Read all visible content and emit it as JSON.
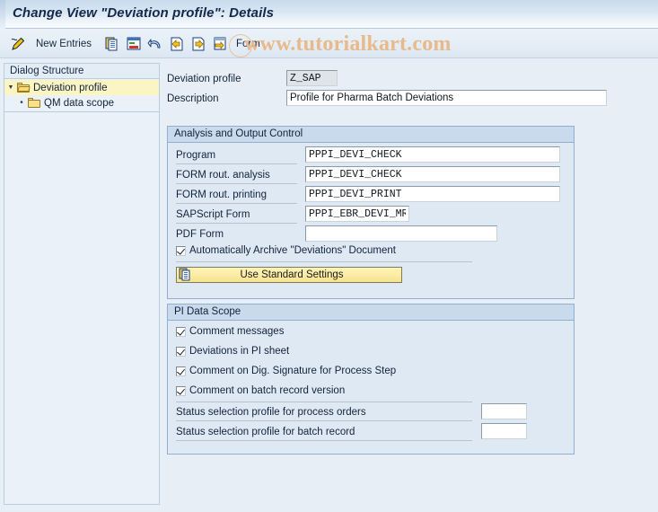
{
  "window": {
    "title": "Change View \"Deviation profile\": Details"
  },
  "watermark": {
    "text": "www.tutorialkart.com"
  },
  "toolbar": {
    "pencil_icon": "edit-pencil-icon",
    "new_entries_label": "New Entries",
    "icons": [
      {
        "name": "copy-icon"
      },
      {
        "name": "delete-row-icon"
      },
      {
        "name": "undo-icon"
      },
      {
        "name": "previous-entry-icon"
      },
      {
        "name": "next-entry-icon"
      },
      {
        "name": "goto-entry-icon"
      }
    ],
    "form_label": "Form"
  },
  "sidebar": {
    "header": "Dialog Structure",
    "items": [
      {
        "label": "Deviation profile",
        "selected": true,
        "level": 0
      },
      {
        "label": "QM data scope",
        "selected": false,
        "level": 1
      }
    ]
  },
  "main": {
    "header_fields": [
      {
        "label": "Deviation profile",
        "value": "Z_SAP",
        "readonly": true
      },
      {
        "label": "Description",
        "value": "Profile for Pharma Batch Deviations",
        "readonly": false
      }
    ],
    "analysis_group": {
      "title": "Analysis and Output Control",
      "fields": [
        {
          "label": "Program",
          "value": "PPPI_DEVI_CHECK"
        },
        {
          "label": "FORM rout. analysis",
          "value": "PPPI_DEVI_CHECK"
        },
        {
          "label": "FORM rout. printing",
          "value": "PPPI_DEVI_PRINT"
        },
        {
          "label": "SAPScript Form",
          "value": "PPPI_EBR_DEVI_MR"
        },
        {
          "label": "PDF Form",
          "value": ""
        }
      ],
      "checkbox": {
        "label": "Automatically Archive \"Deviations\" Document",
        "checked": true
      },
      "button": {
        "label": "Use Standard Settings",
        "icon": "copy-document-icon"
      }
    },
    "pi_group": {
      "title": "PI Data Scope",
      "checkboxes": [
        {
          "label": "Comment messages",
          "checked": true
        },
        {
          "label": "Deviations in PI sheet",
          "checked": true
        },
        {
          "label": "Comment on Dig. Signature for Process Step",
          "checked": true
        },
        {
          "label": "Comment on batch record version",
          "checked": true
        }
      ],
      "fields": [
        {
          "label": "Status selection profile for process orders",
          "value": ""
        },
        {
          "label": "Status selection profile for batch record",
          "value": ""
        }
      ]
    }
  },
  "colors": {
    "title_gradient_start": "#c9dbec",
    "group_header": "#c8daeb",
    "group_body": "#dfe9f4",
    "selected_tree_row": "#fbf5c4",
    "button_yellow": "#fbeda4",
    "watermark": "#e8b98a"
  }
}
